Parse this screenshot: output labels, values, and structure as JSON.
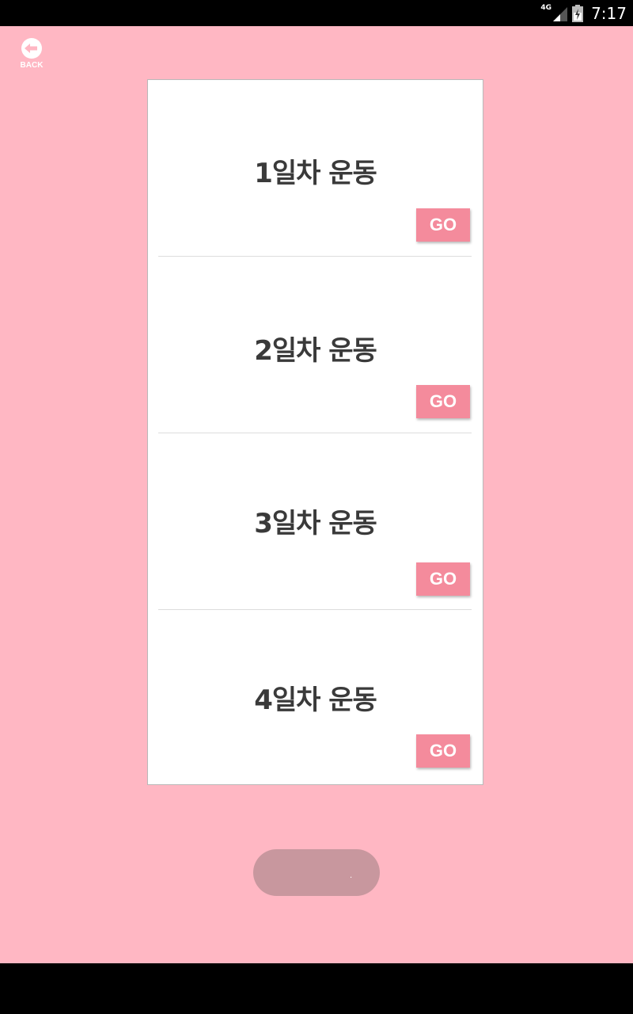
{
  "status_bar": {
    "network": "4G",
    "time": "7:17"
  },
  "back": {
    "label": "BACK",
    "icon": "back-arrow-icon"
  },
  "days": [
    {
      "title": "1일차 운동",
      "button": "GO"
    },
    {
      "title": "2일차 운동",
      "button": "GO"
    },
    {
      "title": "3일차 운동",
      "button": "GO"
    },
    {
      "title": "4일차 운동",
      "button": "GO"
    }
  ],
  "bottom_button": {
    "label": "."
  },
  "colors": {
    "background": "#ffb7c3",
    "go_button": "#f48b9c",
    "pill": "#c8979e",
    "title_text": "#3a3a3a"
  }
}
